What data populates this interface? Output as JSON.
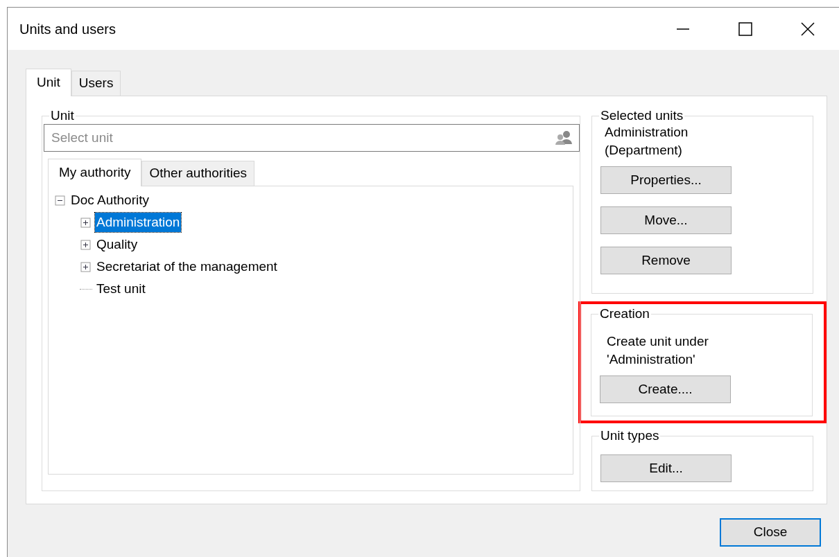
{
  "window": {
    "title": "Units and users"
  },
  "tabs": [
    {
      "label": "Unit",
      "selected": true
    },
    {
      "label": "Users",
      "selected": false
    }
  ],
  "unit_group": {
    "title": "Unit",
    "search": {
      "placeholder": "Select unit"
    },
    "tabs": [
      {
        "label": "My authority",
        "selected": true
      },
      {
        "label": "Other authorities",
        "selected": false
      }
    ],
    "tree": [
      {
        "label": "Doc Authority",
        "expanded": true,
        "selected": false,
        "children": [
          {
            "label": "Administration",
            "selected": true,
            "has_children": true
          },
          {
            "label": "Quality",
            "selected": false,
            "has_children": true
          },
          {
            "label": "Secretariat of the management",
            "selected": false,
            "has_children": true
          },
          {
            "label": "Test unit",
            "selected": false,
            "has_children": false
          }
        ]
      }
    ]
  },
  "selected_units": {
    "title": "Selected units",
    "text": "Administration\n(Department)",
    "buttons": [
      "Properties...",
      "Move...",
      "Remove"
    ]
  },
  "creation": {
    "title": "Creation",
    "highlighted": true,
    "text": "Create unit under\n'Administration'",
    "buttons": [
      "Create...."
    ]
  },
  "unit_types": {
    "title": "Unit types",
    "buttons": [
      "Edit..."
    ]
  },
  "footer": {
    "buttons": [
      {
        "label": "Close",
        "default": true
      }
    ]
  }
}
